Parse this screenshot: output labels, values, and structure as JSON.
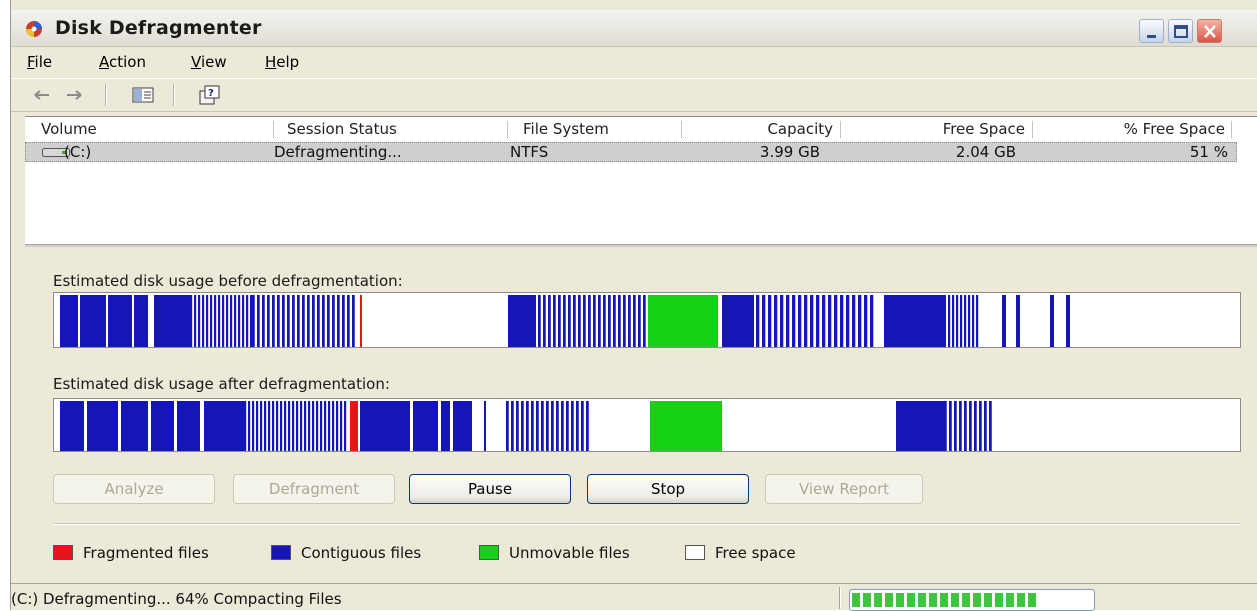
{
  "window": {
    "title": "Disk Defragmenter"
  },
  "menu": [
    {
      "label": "File",
      "key": "F",
      "rest": "ile"
    },
    {
      "label": "Action",
      "key": "A",
      "rest": "ction"
    },
    {
      "label": "View",
      "key": "V",
      "rest": "iew"
    },
    {
      "label": "Help",
      "key": "H",
      "rest": "elp"
    }
  ],
  "toolbar": {
    "icons": [
      "back-arrow-icon",
      "forward-arrow-icon",
      "show-hide-console-icon",
      "help-icon"
    ]
  },
  "volumes": {
    "columns": [
      "Volume",
      "Session Status",
      "File System",
      "Capacity",
      "Free Space",
      "% Free Space"
    ],
    "rows": [
      {
        "volume": "(C:)",
        "status": "Defragmenting...",
        "file_system": "NTFS",
        "capacity": "3.99 GB",
        "free_space": "2.04 GB",
        "percent_free": "51 %"
      }
    ]
  },
  "usage": {
    "before_label": "Estimated disk usage before defragmentation:",
    "after_label": "Estimated disk usage after defragmentation:"
  },
  "buttons": {
    "analyze": "Analyze",
    "defragment": "Defragment",
    "pause": "Pause",
    "stop": "Stop",
    "view_report": "View Report"
  },
  "legend": [
    {
      "label": "Fragmented files",
      "color": "#e8141c"
    },
    {
      "label": "Contiguous files",
      "color": "#1616b8"
    },
    {
      "label": "Unmovable files",
      "color": "#17d117"
    },
    {
      "label": "Free space",
      "color": "#ffffff"
    }
  ],
  "status": {
    "text": "(C:) Defragmenting... 64%  Compacting Files",
    "progress": 0.64
  }
}
